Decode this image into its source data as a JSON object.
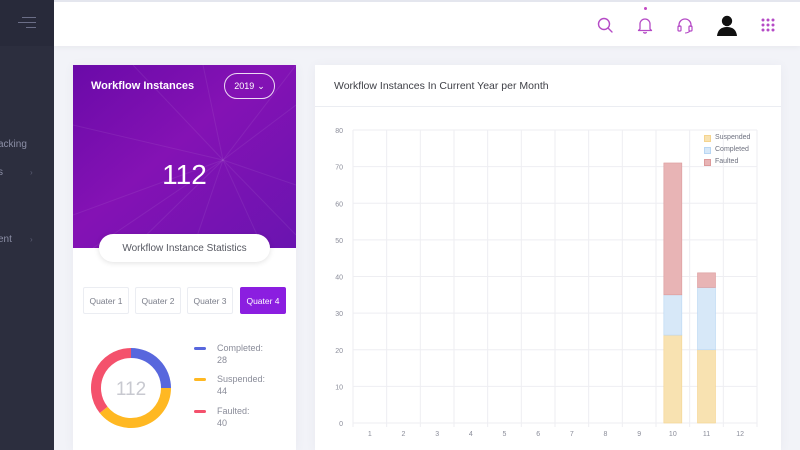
{
  "sidebar": {
    "items": [
      {
        "label": "acking"
      },
      {
        "label": "s"
      },
      {
        "label": "ent"
      }
    ]
  },
  "topbar": {
    "icons": [
      "search-icon",
      "bell-icon",
      "headset-icon",
      "user-avatar-icon",
      "apps-grid-icon"
    ],
    "accent": "#b54ac6"
  },
  "workflow_card": {
    "title": "Workflow Instances",
    "year": "2019",
    "total": "112",
    "stats_label": "Workflow Instance Statistics",
    "quarters": [
      "Quater 1",
      "Quater 2",
      "Quater 3",
      "Quater 4"
    ],
    "active_quarter": "Quater 4",
    "donut_total": "112",
    "legend": [
      {
        "label": "Completed:",
        "value": "28",
        "color": "#5867dd"
      },
      {
        "label": "Suspended:",
        "value": "44",
        "color": "#ffb822"
      },
      {
        "label": "Faulted:",
        "value": "40",
        "color": "#f4516c"
      }
    ]
  },
  "chart_card": {
    "title": "Workflow Instances In Current Year per Month"
  },
  "chart_data": {
    "type": "bar",
    "stacked": true,
    "categories": [
      "1",
      "2",
      "3",
      "4",
      "5",
      "6",
      "7",
      "8",
      "9",
      "10",
      "11",
      "12"
    ],
    "series": [
      {
        "name": "Suspended",
        "fill": "#f8e2b1",
        "stroke": "#f5d48e",
        "values": [
          0,
          0,
          0,
          0,
          0,
          0,
          0,
          0,
          0,
          24,
          20,
          0
        ]
      },
      {
        "name": "Completed",
        "fill": "#d7e8f8",
        "stroke": "#b8d6f3",
        "values": [
          0,
          0,
          0,
          0,
          0,
          0,
          0,
          0,
          0,
          11,
          17,
          0
        ]
      },
      {
        "name": "Faulted",
        "fill": "#e8b4b5",
        "stroke": "#dc9a9b",
        "values": [
          0,
          0,
          0,
          0,
          0,
          0,
          0,
          0,
          0,
          36,
          4,
          0
        ]
      }
    ],
    "ylim": [
      0,
      80
    ],
    "yticks": [
      "0",
      "10",
      "20",
      "30",
      "40",
      "50",
      "60",
      "70",
      "80"
    ],
    "grid": true,
    "legend": "top-right"
  }
}
